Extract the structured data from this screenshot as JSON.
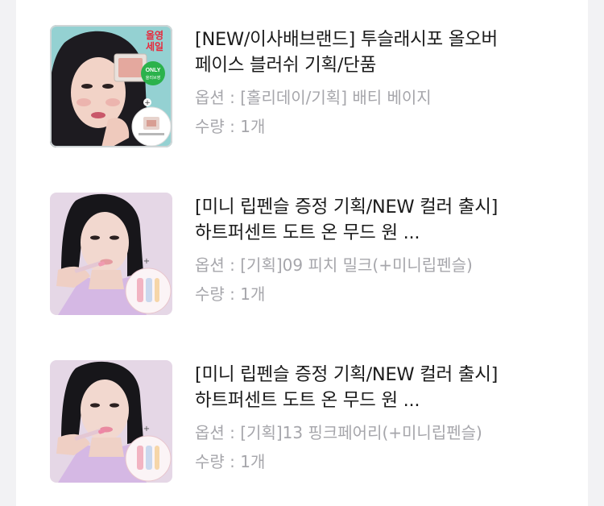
{
  "items": [
    {
      "title": "[NEW/이사배브랜드] 투슬래시포 올오버 페이스 블러쉬 기획/단품",
      "option": "옵션 : [홀리데이/기획] 배티 베이지",
      "quantity": "수량 : 1개",
      "badge_line1": "올영",
      "badge_line2": "세일",
      "only_badge": "ONLY",
      "only_badge_sub": "올리브영"
    },
    {
      "title": "[미니 립펜슬 증정 기획/NEW 컬러 출시] 하트퍼센트 도트 온 무드 원 ...",
      "option": "옵션 : [기획]09 피치 밀크(+미니립펜슬)",
      "quantity": "수량 : 1개"
    },
    {
      "title": "[미니 립펜슬 증정 기획/NEW 컬러 출시] 하트퍼센트 도트 온 무드 원 ...",
      "option": "옵션 : [기획]13 핑크페어리(+미니립펜슬)",
      "quantity": "수량 : 1개"
    }
  ],
  "colors": {
    "background": "#f2f2f4",
    "card": "#ffffff",
    "title_text": "#1b1b1b",
    "meta_text": "#a6a6ab",
    "badge_red": "#e8283b",
    "only_green": "#2bb24c"
  }
}
